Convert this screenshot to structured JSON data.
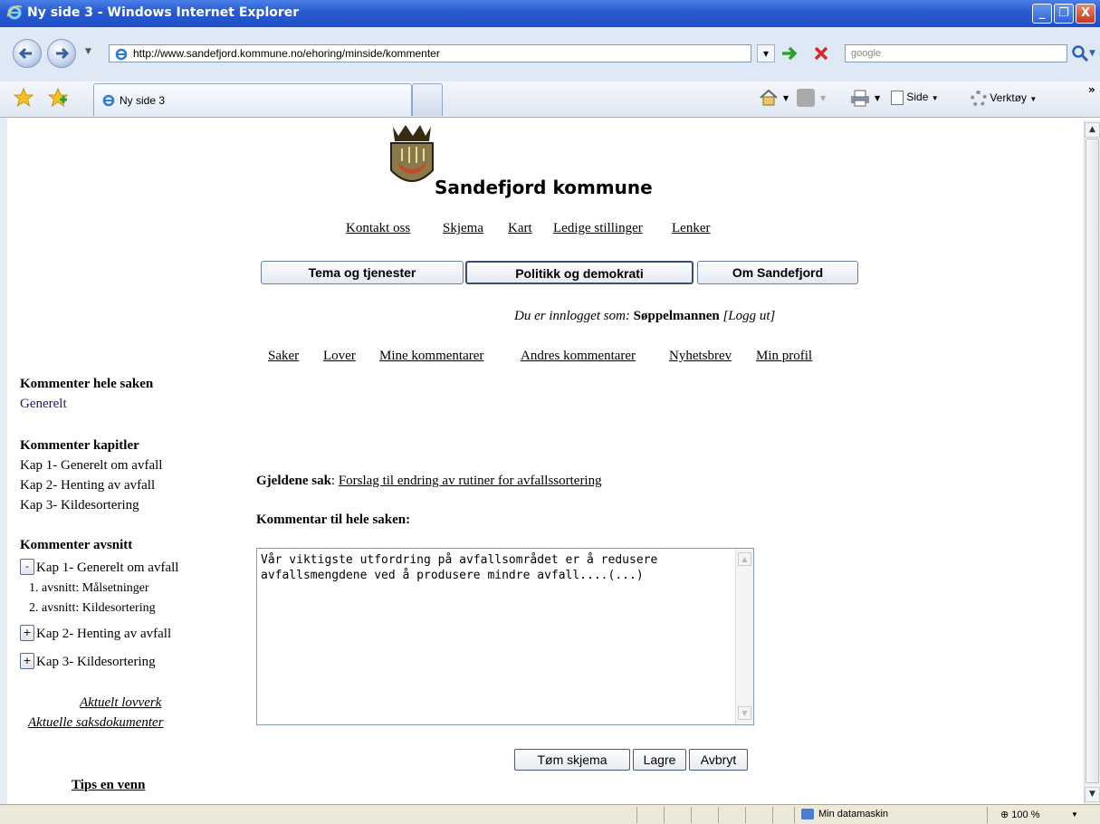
{
  "window": {
    "title": "Ny side 3 - Windows Internet Explorer",
    "minimize": "_",
    "restore": "❐",
    "close": "X"
  },
  "address": {
    "url": "http://www.sandefjord.kommune.no/ehoring/minside/kommenter",
    "search_placeholder": "google"
  },
  "tabs": {
    "active_label": "Ny side 3"
  },
  "toolbar": {
    "side_label": "Side",
    "tools_label": "Verktøy",
    "more": "»"
  },
  "site": {
    "name": "Sandefjord kommune",
    "top_links": [
      "Kontakt oss",
      "Skjema",
      "Kart",
      "Ledige stillinger",
      "Lenker"
    ],
    "main_nav": [
      "Tema og tjenester",
      "Politikk og demokrati",
      "Om Sandefjord"
    ],
    "login_prefix": "Du er innlogget som:",
    "login_user": "Søppelmannen",
    "logout": "[Logg ut]",
    "sub_nav": [
      "Saker",
      "Lover",
      "Mine kommentarer",
      "Andres kommentarer",
      "Nyhetsbrev",
      "Min profil"
    ]
  },
  "sidebar": {
    "whole_heading": "Kommenter hele saken",
    "whole_link": "Generelt",
    "chapters_heading": "Kommenter kapitler",
    "chapters": [
      "Kap 1- Generelt om avfall",
      "Kap 2- Henting av avfall",
      "Kap 3- Kildesortering"
    ],
    "sections_heading": "Kommenter avsnitt",
    "tree": [
      {
        "toggle": "-",
        "label": "Kap 1- Generelt om avfall"
      },
      {
        "toggle": "+",
        "label": "Kap 2- Henting av avfall"
      },
      {
        "toggle": "+",
        "label": "Kap 3- Kildesortering"
      }
    ],
    "kap1_sections": [
      "1. avsnitt: Målsetninger",
      "2. avsnitt: Kildesortering"
    ],
    "law_link": "Aktuelt lovverk",
    "docs_link": "Aktuelle saksdokumenter",
    "tips": "Tips en venn"
  },
  "form": {
    "case_label": "Gjeldene sak",
    "case_sep": ":",
    "case_link": "Forslag til endring av rutiner for avfallssortering",
    "comment_heading": "Kommentar til hele saken:",
    "comment_value": "Vår viktigste utfordring på avfallsområdet er å redusere avfallsmengdene ved å produsere mindre avfall....(...)",
    "clear_button": "Tøm skjema",
    "save_button": "Lagre",
    "cancel_button": "Avbryt"
  },
  "status": {
    "zone": "Min datamaskin",
    "zoom": "100 %"
  }
}
